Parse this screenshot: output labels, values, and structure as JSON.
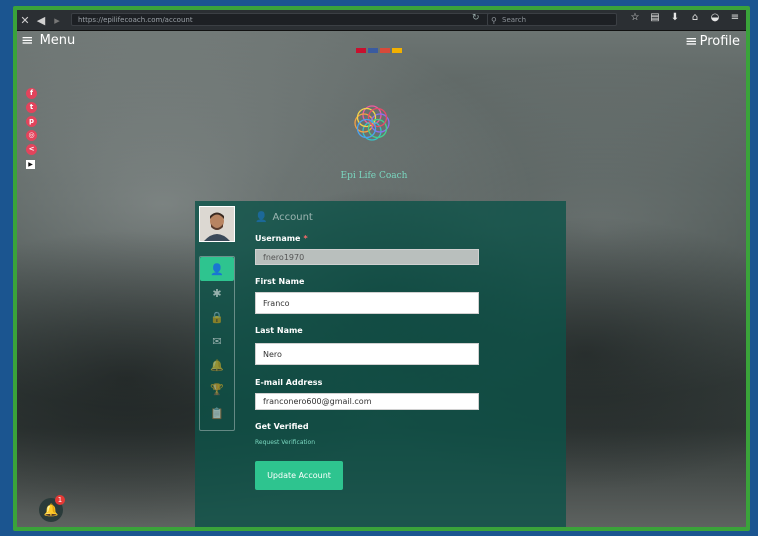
{
  "browser": {
    "url": "https://epilifecoach.com/account",
    "search_placeholder": "Search"
  },
  "nav": {
    "menu_label": "Menu",
    "profile_label": "Profile"
  },
  "brand": {
    "name": "Epi Life Coach"
  },
  "account": {
    "heading": "Account",
    "username_label": "Username",
    "username_required": "*",
    "username_value": "fnero1970",
    "first_name_label": "First Name",
    "first_name_value": "Franco",
    "last_name_label": "Last Name",
    "last_name_value": "Nero",
    "email_label": "E-mail Address",
    "email_value": "franconero600@gmail.com",
    "verified_label": "Get Verified",
    "verify_link": "Request Verification",
    "update_button": "Update Account"
  },
  "notifications": {
    "count": "1"
  },
  "colors": {
    "accent": "#2ec48f",
    "panel": "#0c5248",
    "social": "#e2445c"
  },
  "icons": {
    "social": [
      "facebook-icon",
      "twitter-icon",
      "pinterest-icon",
      "instagram-icon",
      "share-icon"
    ],
    "tabs": [
      "user-icon",
      "gear-icon",
      "lock-icon",
      "envelope-icon",
      "bell-icon",
      "trophy-icon",
      "clipboard-icon"
    ]
  }
}
